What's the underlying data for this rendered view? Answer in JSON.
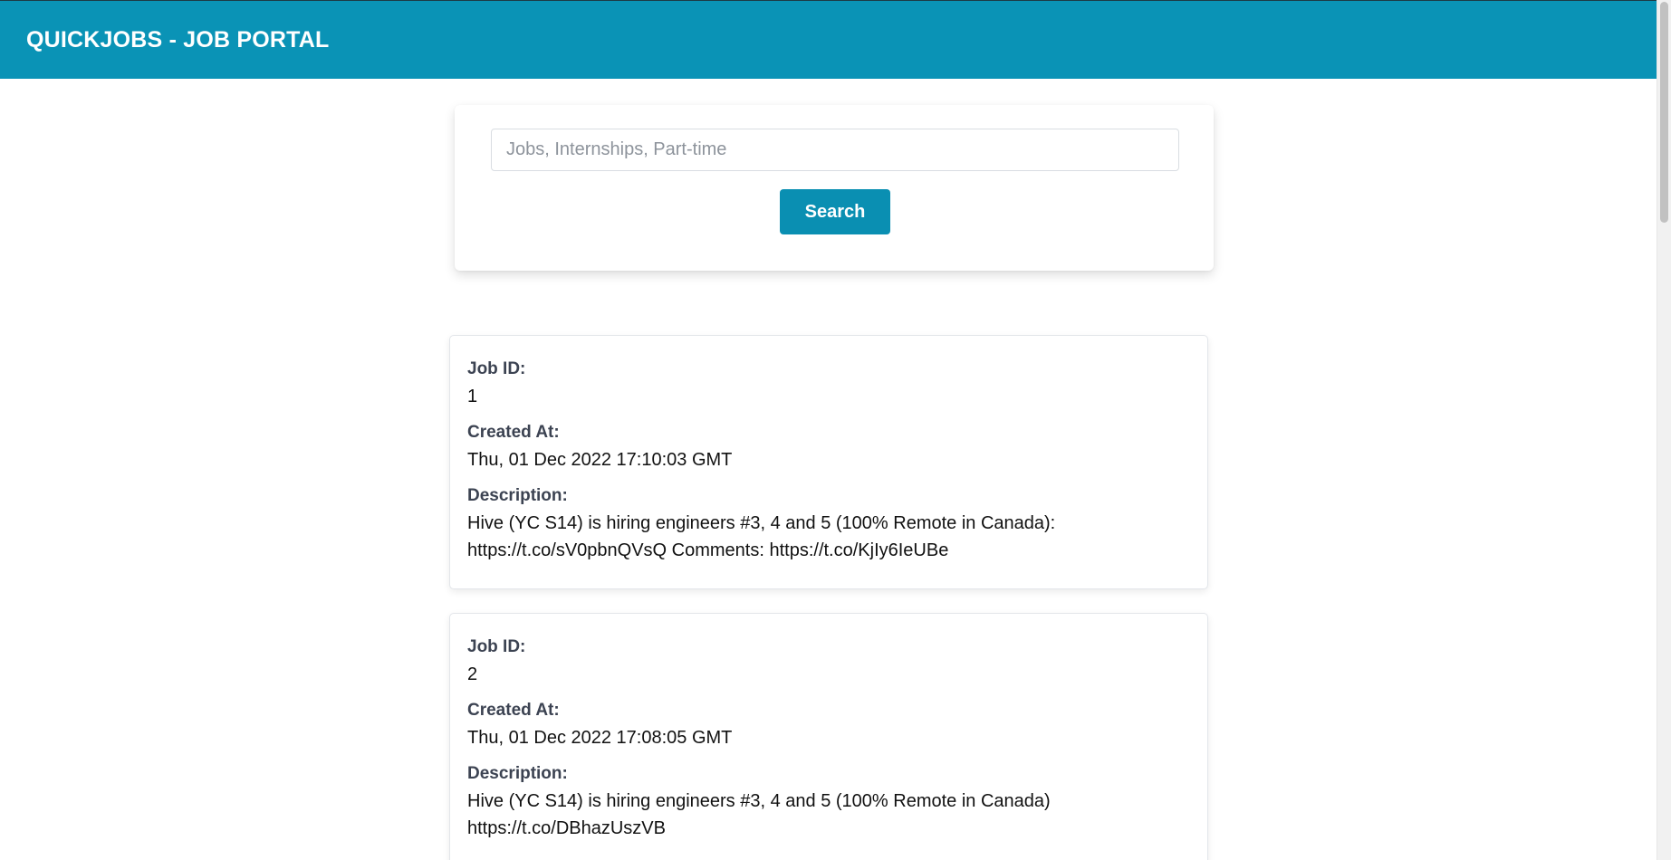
{
  "header": {
    "title": "QUICKJOBS - JOB PORTAL"
  },
  "search": {
    "placeholder": "Jobs, Internships, Part-time",
    "value": "",
    "button_label": "Search"
  },
  "jobs": [
    {
      "id_label": "Job ID:",
      "id": "1",
      "created_label": "Created At:",
      "created_at": "Thu, 01 Dec 2022 17:10:03 GMT",
      "description_label": "Description:",
      "description_line1": "Hive (YC S14) is hiring engineers #3, 4 and 5 (100% Remote in Canada):",
      "description_line2": "https://t.co/sV0pbnQVsQ Comments: https://t.co/KjIy6IeUBe"
    },
    {
      "id_label": "Job ID:",
      "id": "2",
      "created_label": "Created At:",
      "created_at": "Thu, 01 Dec 2022 17:08:05 GMT",
      "description_label": "Description:",
      "description_line1": "Hive (YC S14) is hiring engineers #3, 4 and 5 (100% Remote in Canada)",
      "description_line2": "https://t.co/DBhazUszVB"
    }
  ],
  "colors": {
    "header_bg": "#0a93b6",
    "button_bg": "#0a8fb2"
  }
}
